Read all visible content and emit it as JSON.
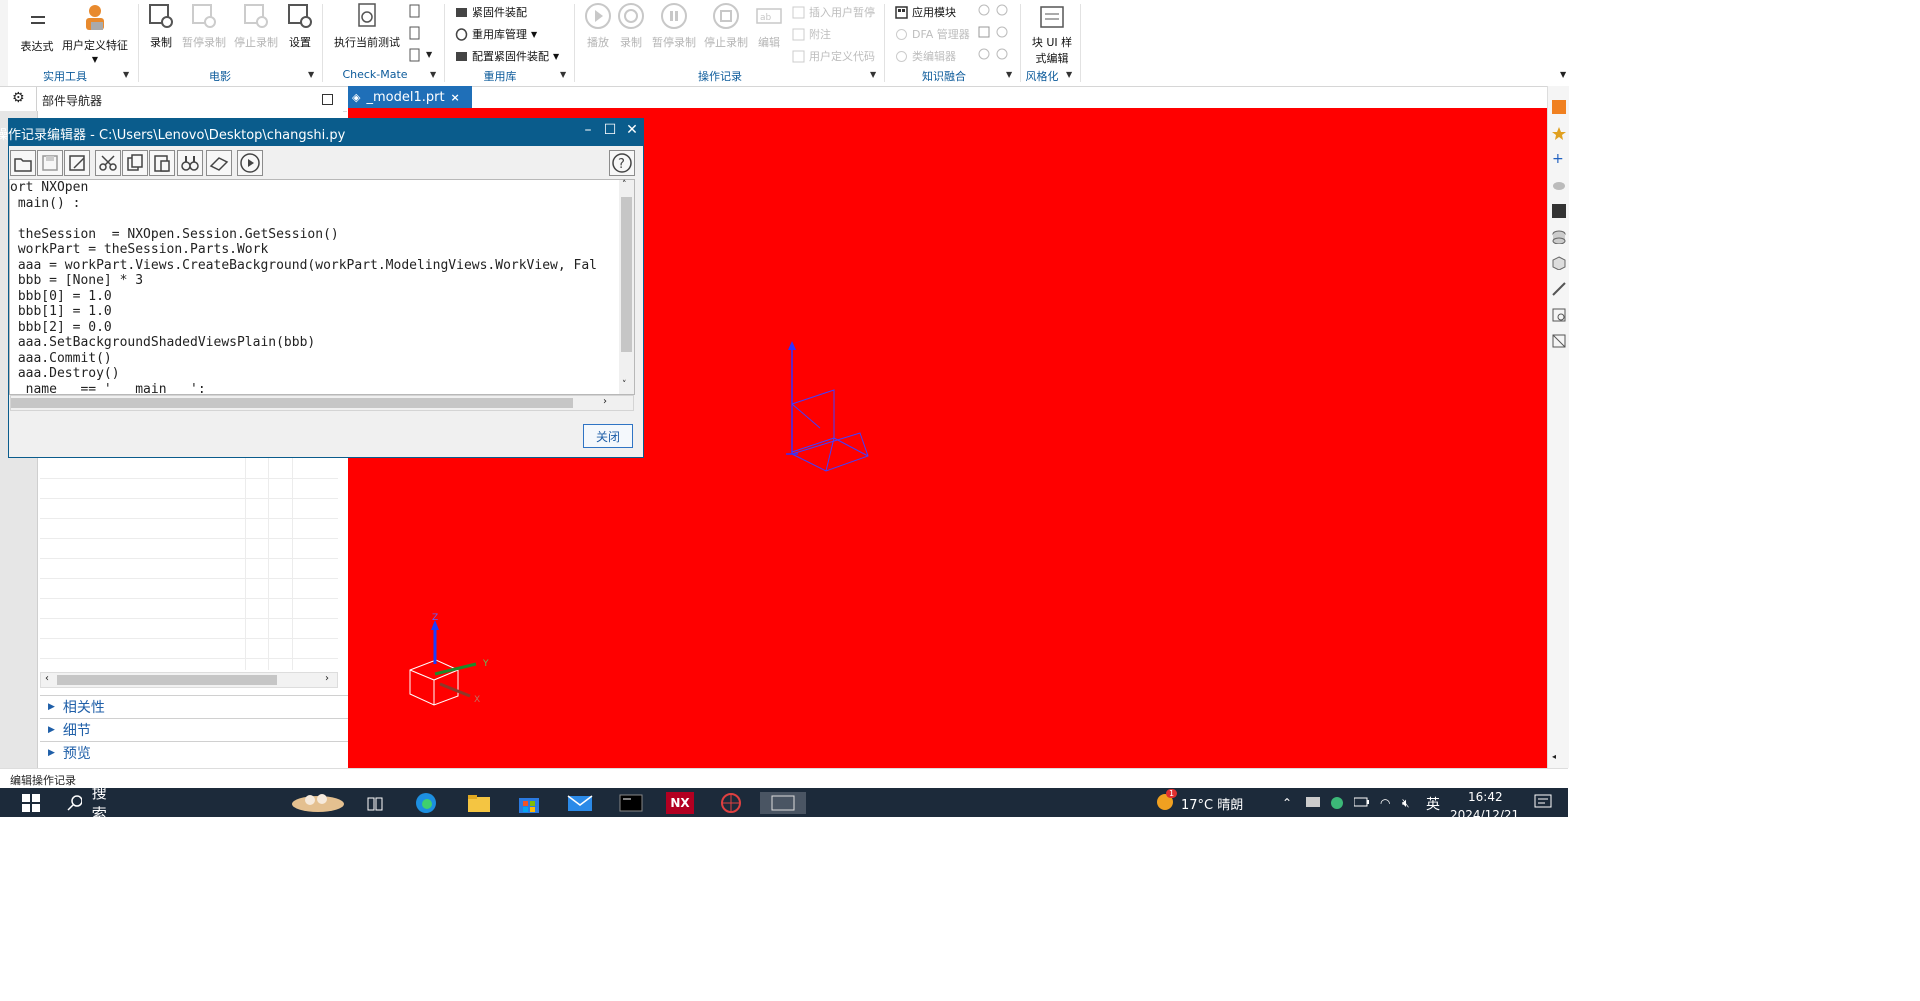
{
  "ribbon": {
    "groups": [
      {
        "label": "实用工具",
        "buttons": [
          "表达式",
          "用户定义特征"
        ]
      },
      {
        "label": "电影",
        "buttons": [
          "录制",
          "暂停录制",
          "停止录制",
          "设置"
        ]
      },
      {
        "label": "Check-Mate",
        "buttons": [
          "执行当前测试"
        ]
      },
      {
        "label": "重用库",
        "items": [
          "紧固件装配",
          "重用库管理",
          "配置紧固件装配"
        ]
      },
      {
        "label": "操作记录",
        "buttons": [
          "播放",
          "录制",
          "暂停录制",
          "停止录制",
          "编辑"
        ],
        "items": [
          "插入用户暂停",
          "附注",
          "用户定义代码"
        ]
      },
      {
        "label": "知识融合",
        "items": [
          "应用模块",
          "DFA 管理器",
          "类编辑器"
        ]
      },
      {
        "label": "风格化",
        "buttons": [
          "块 UI 样",
          "式编辑"
        ]
      }
    ]
  },
  "nav": {
    "title": "部件导航器",
    "sections": [
      "相关性",
      "细节",
      "预览"
    ]
  },
  "graphics": {
    "tab_label": "_model1.prt",
    "bg_color": "#ff0000",
    "triad": {
      "y": "Y",
      "z": "Z",
      "x": "X"
    }
  },
  "dialog": {
    "title": "操作记录编辑器 - C:\\Users\\Lenovo\\Desktop\\changshi.py",
    "code_lines": [
      "ort NXOpen",
      " main() :",
      "",
      " theSession  = NXOpen.Session.GetSession()",
      " workPart = theSession.Parts.Work",
      " aaa = workPart.Views.CreateBackground(workPart.ModelingViews.WorkView, Fal",
      " bbb = [None] * 3",
      " bbb[0] = 1.0",
      " bbb[1] = 1.0",
      " bbb[2] = 0.0",
      " aaa.SetBackgroundShadedViewsPlain(bbb)",
      " aaa.Commit()",
      " aaa.Destroy()",
      "  name   == '   main   ':"
    ],
    "close_label": "关闭",
    "help_label": "?"
  },
  "status": {
    "text": "编辑操作记录"
  },
  "taskbar": {
    "search_label": "搜索",
    "weather": "17°C 晴朗",
    "time": "16:42",
    "date": "2024/12/21",
    "lang": "英",
    "nx_label": "NX",
    "weather_badge": "1"
  }
}
